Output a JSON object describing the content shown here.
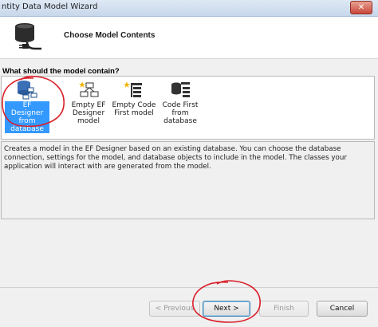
{
  "window": {
    "title": "ntity Data Model Wizard",
    "close_glyph": "✕"
  },
  "header": {
    "title": "Choose Model Contents",
    "icon": "database-plug-icon"
  },
  "section": {
    "label": "What should the model contain?"
  },
  "options": [
    {
      "line1": "EF Designer",
      "line2": "from",
      "line3": "database",
      "icon": "database-model-icon",
      "selected": true
    },
    {
      "line1": "Empty EF",
      "line2": "Designer",
      "line3": "model",
      "icon": "empty-model-icon",
      "selected": false
    },
    {
      "line1": "Empty Code",
      "line2": "First model",
      "line3": "",
      "icon": "empty-code-first-icon",
      "selected": false
    },
    {
      "line1": "Code First",
      "line2": "from",
      "line3": "database",
      "icon": "code-first-database-icon",
      "selected": false
    }
  ],
  "description": "Creates a model in the EF Designer based on an existing database. You can choose the database connection, settings for the model, and database objects to include in the model. The classes your application will interact with are generated from the model.",
  "buttons": {
    "previous": "< Previous",
    "next": "Next >",
    "finish": "Finish",
    "cancel": "Cancel"
  },
  "colors": {
    "selection": "#3399ff",
    "annotation": "#d9202a"
  }
}
